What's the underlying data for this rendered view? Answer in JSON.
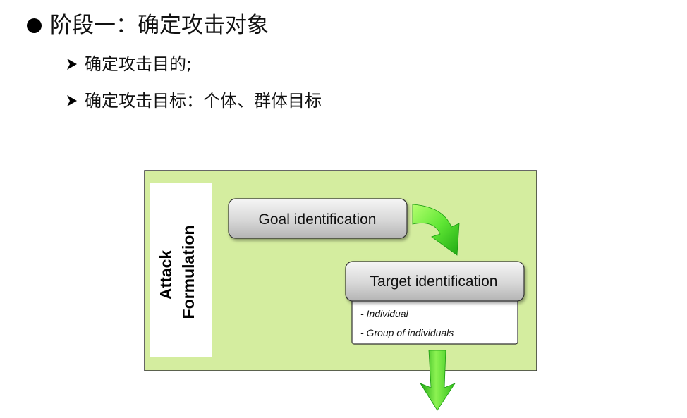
{
  "heading": {
    "text": "阶段一：确定攻击对象"
  },
  "sub_points": [
    "确定攻击目的;",
    "确定攻击目标：个体、群体目标"
  ],
  "diagram": {
    "side_label_line1": "Attack",
    "side_label_line2": "Formulation",
    "goal_box": "Goal identification",
    "target_box": "Target identification",
    "target_details": [
      "- Individual",
      "- Group of individuals"
    ],
    "colors": {
      "panel_fill": "#d4ed9f",
      "box_fill_top": "#f4f4f4",
      "box_fill_bottom": "#b9b9b9",
      "arrow_light": "#a6ff5a",
      "arrow_dark": "#1fae10"
    }
  }
}
